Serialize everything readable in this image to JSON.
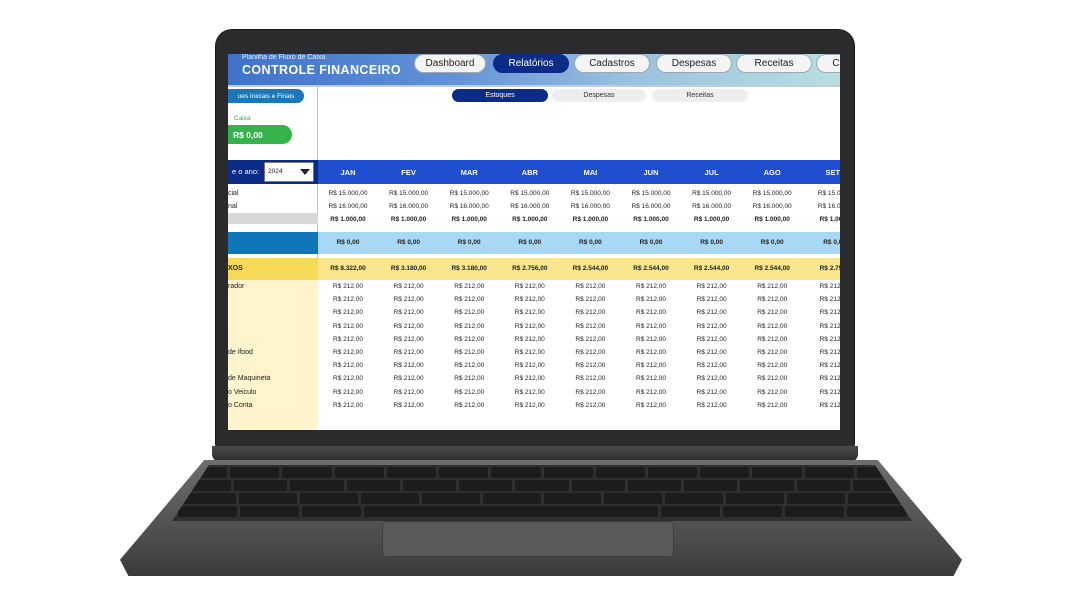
{
  "app": {
    "subtitle": "Planilha de Fluxo de Caixa",
    "title": "CONTROLE FINANCEIRO"
  },
  "nav": [
    {
      "label": "Dashboard",
      "active": false
    },
    {
      "label": "Relatórios",
      "active": true
    },
    {
      "label": "Cadastros",
      "active": false
    },
    {
      "label": "Despesas",
      "active": false
    },
    {
      "label": "Receitas",
      "active": false
    },
    {
      "label": "C",
      "active": false
    }
  ],
  "subtabs": [
    {
      "label": "Estoques",
      "active": true
    },
    {
      "label": "Despesas",
      "active": false
    },
    {
      "label": "Receitas",
      "active": false
    }
  ],
  "sidebar": {
    "saldos_button": "ues Iniciais e Finais",
    "caixa_label": "Caixa",
    "caixa_value": "R$ 0,00"
  },
  "year": {
    "label": "e o ano:",
    "value": "2024"
  },
  "months": [
    "JAN",
    "FEV",
    "MAR",
    "ABR",
    "MAI",
    "JUN",
    "JUL",
    "AGO",
    "SET"
  ],
  "row_labels": {
    "inicial": "cial",
    "final": "nal",
    "fluxos": "XOS",
    "items": [
      "rador",
      "",
      "",
      "",
      "",
      "de ifood",
      "",
      "de Maquineta",
      "o Veiculo",
      "o Conta"
    ]
  },
  "rows": {
    "inicial": [
      "R$ 15.000,00",
      "R$ 15.000,00",
      "R$ 15.000,00",
      "R$ 15.000,00",
      "R$ 15.000,00",
      "R$ 15.000,00",
      "R$ 15.000,00",
      "R$ 15.000,00",
      "R$ 15.000"
    ],
    "final": [
      "R$ 16.000,00",
      "R$ 16.000,00",
      "R$ 16.000,00",
      "R$ 16.000,00",
      "R$ 16.000,00",
      "R$ 16.000,00",
      "R$ 16.000,00",
      "R$ 16.000,00",
      "R$ 16.000"
    ],
    "diff": [
      "R$ 1.000,00",
      "R$ 1.000,00",
      "R$ 1.000,00",
      "R$ 1.000,00",
      "R$ 1.000,00",
      "R$ 1.000,00",
      "R$ 1.000,00",
      "R$ 1.000,00",
      "R$ 1.000"
    ],
    "blue": [
      "R$ 0,00",
      "R$ 0,00",
      "R$ 0,00",
      "R$ 0,00",
      "R$ 0,00",
      "R$ 0,00",
      "R$ 0,00",
      "R$ 0,00",
      "R$ 0,0"
    ],
    "yellow": [
      "R$ 8.322,00",
      "R$ 3.180,00",
      "R$ 3.180,00",
      "R$ 2.756,00",
      "R$ 2.544,00",
      "R$ 2.544,00",
      "R$ 2.544,00",
      "R$ 2.544,00",
      "R$ 2.756"
    ],
    "item_value": [
      "R$ 212,00",
      "R$ 212,00",
      "R$ 212,00",
      "R$ 212,00",
      "R$ 212,00",
      "R$ 212,00",
      "R$ 212,00",
      "R$ 212,00",
      "R$ 212,0"
    ]
  }
}
